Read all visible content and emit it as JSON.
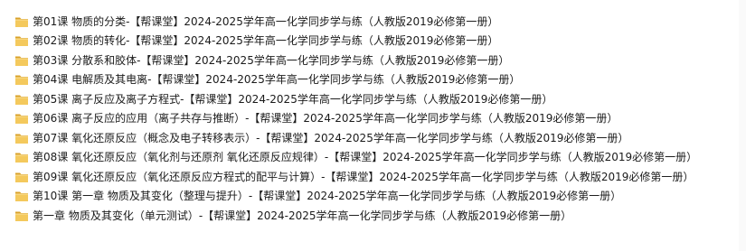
{
  "icons": {
    "folder": "folder-icon",
    "folder_color": "#e8b33a"
  },
  "items": [
    {
      "label": "第01课 物质的分类-【帮课堂】2024-2025学年高一化学同步学与练（人教版2019必修第一册）"
    },
    {
      "label": "第02课 物质的转化-【帮课堂】2024-2025学年高一化学同步学与练（人教版2019必修第一册）"
    },
    {
      "label": "第03课 分散系和胶体-【帮课堂】2024-2025学年高一化学同步学与练（人教版2019必修第一册）"
    },
    {
      "label": "第04课 电解质及其电离-【帮课堂】2024-2025学年高一化学同步学与练（人教版2019必修第一册）"
    },
    {
      "label": "第05课 离子反应及离子方程式-【帮课堂】2024-2025学年高一化学同步学与练（人教版2019必修第一册）"
    },
    {
      "label": "第06课 离子反应的应用（离子共存与推断）-【帮课堂】2024-2025学年高一化学同步学与练（人教版2019必修第一册）"
    },
    {
      "label": "第07课 氧化还原反应（概念及电子转移表示）-【帮课堂】2024-2025学年高一化学同步学与练（人教版2019必修第一册）"
    },
    {
      "label": "第08课 氧化还原反应（氧化剂与还原剂 氧化还原反应规律）-【帮课堂】2024-2025学年高一化学同步学与练（人教版2019必修第一册）"
    },
    {
      "label": "第09课 氧化还原反应（氧化还原反应方程式的配平与计算）-【帮课堂】2024-2025学年高一化学同步学与练（人教版2019必修第一册）"
    },
    {
      "label": "第10课 第一章 物质及其变化（整理与提升）-【帮课堂】2024-2025学年高一化学同步学与练（人教版2019必修第一册）"
    },
    {
      "label": "第一章 物质及其变化（单元测试）-【帮课堂】2024-2025学年高一化学同步学与练（人教版2019必修第一册）"
    }
  ]
}
